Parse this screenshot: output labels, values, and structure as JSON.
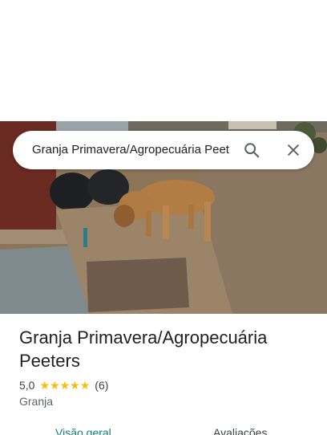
{
  "search": {
    "value": "Granja Primavera/Agropecuária Peeters",
    "placeholder": ""
  },
  "icons": {
    "search": "search-icon",
    "close": "close-icon",
    "star": "star-icon"
  },
  "place": {
    "title": "Granja Primavera/Agropecuária Peeters",
    "rating": "5,0",
    "stars": 5,
    "review_count": "(6)",
    "category": "Granja"
  },
  "tabs": [
    {
      "label": "Visão geral",
      "selected": true
    },
    {
      "label": "Avaliações",
      "selected": false
    }
  ],
  "colors": {
    "accent": "#127b7f",
    "star": "#fbbc04",
    "text": "#202124",
    "secondary_text": "#5f6368"
  }
}
